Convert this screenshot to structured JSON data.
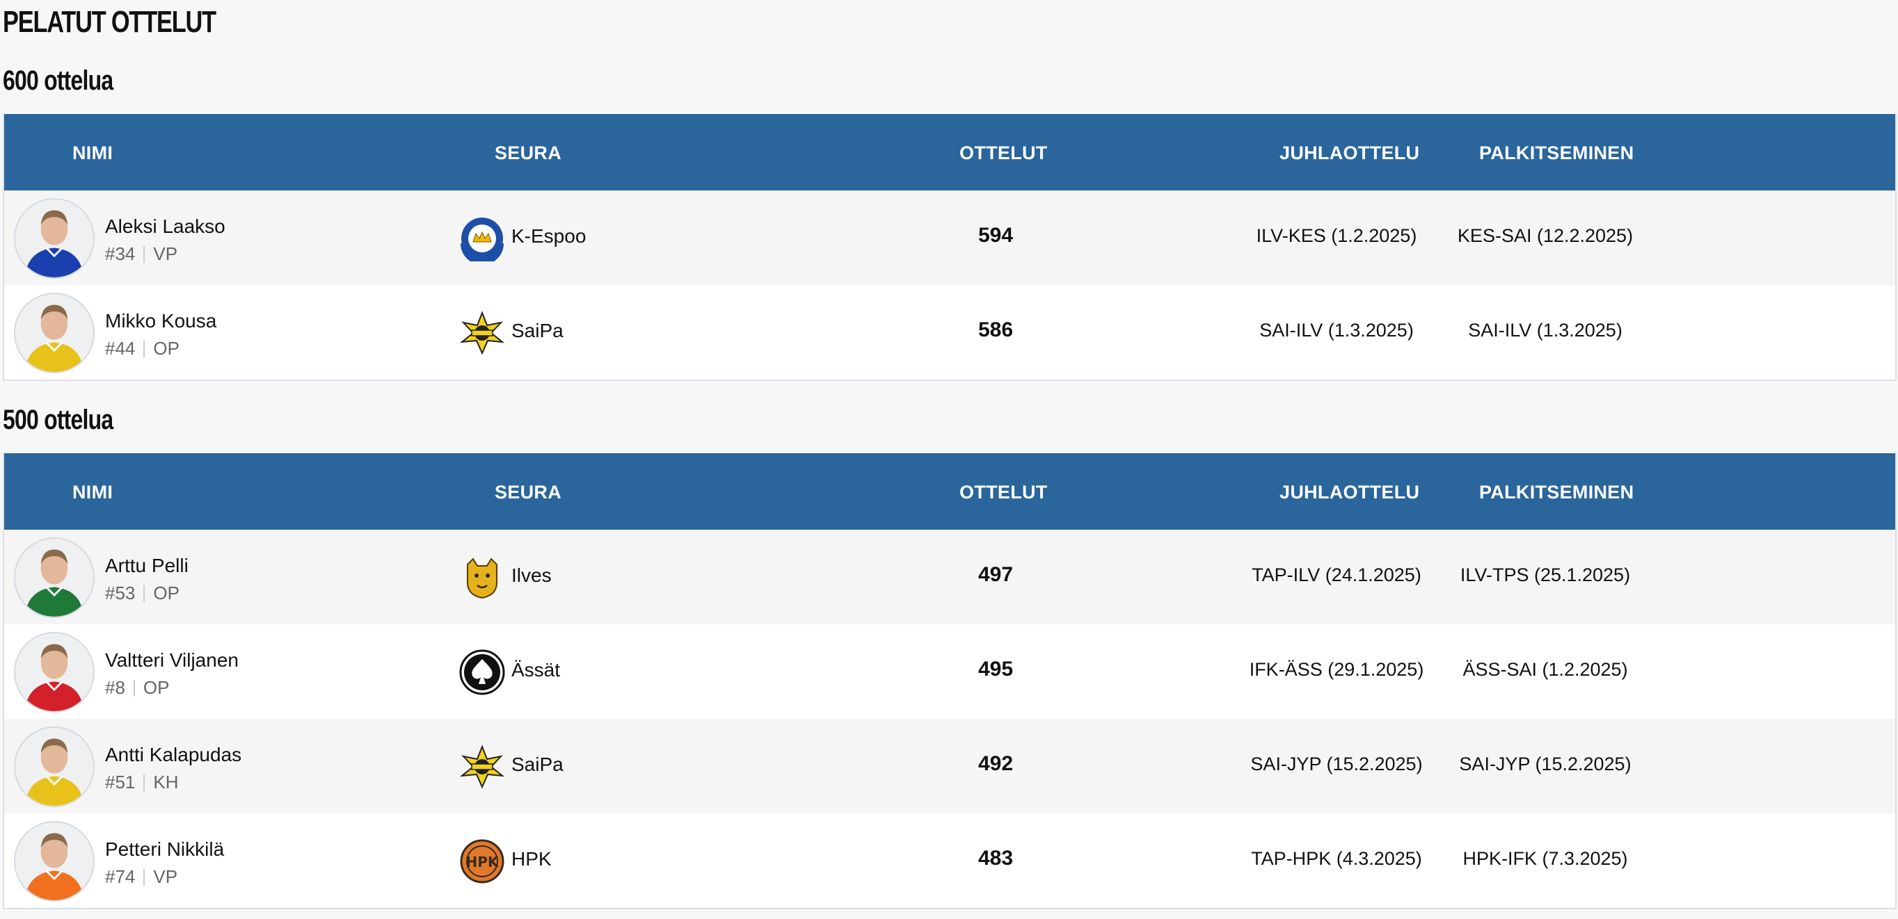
{
  "page_title": "PELATUT OTTELUT",
  "columns": {
    "name": "NIMI",
    "club": "SEURA",
    "games": "OTTELUT",
    "celebration": "JUHLAOTTELU",
    "award": "PALKITSEMINEN"
  },
  "sections": [
    {
      "title": "600 ottelua",
      "rows": [
        {
          "name": "Aleksi Laakso",
          "number": "#34",
          "position": "VP",
          "club": "K-Espoo",
          "club_logo": "k-espoo-logo",
          "games": "594",
          "celebration": "ILV-KES (1.2.2025)",
          "award": "KES-SAI (12.2.2025)",
          "jersey_color": "#1a3fae"
        },
        {
          "name": "Mikko Kousa",
          "number": "#44",
          "position": "OP",
          "club": "SaiPa",
          "club_logo": "saipa-logo",
          "games": "586",
          "celebration": "SAI-ILV (1.3.2025)",
          "award": "SAI-ILV (1.3.2025)",
          "jersey_color": "#e8c21a"
        }
      ]
    },
    {
      "title": "500 ottelua",
      "rows": [
        {
          "name": "Arttu Pelli",
          "number": "#53",
          "position": "OP",
          "club": "Ilves",
          "club_logo": "ilves-logo",
          "games": "497",
          "celebration": "TAP-ILV (24.1.2025)",
          "award": "ILV-TPS (25.1.2025)",
          "jersey_color": "#1f7a3a"
        },
        {
          "name": "Valtteri Viljanen",
          "number": "#8",
          "position": "OP",
          "club": "Ässät",
          "club_logo": "assat-logo",
          "games": "495",
          "celebration": "IFK-ÄSS (29.1.2025)",
          "award": "ÄSS-SAI (1.2.2025)",
          "jersey_color": "#d4202a"
        },
        {
          "name": "Antti Kalapudas",
          "number": "#51",
          "position": "KH",
          "club": "SaiPa",
          "club_logo": "saipa-logo",
          "games": "492",
          "celebration": "SAI-JYP (15.2.2025)",
          "award": "SAI-JYP (15.2.2025)",
          "jersey_color": "#e8c21a"
        },
        {
          "name": "Petteri Nikkilä",
          "number": "#74",
          "position": "VP",
          "club": "HPK",
          "club_logo": "hpk-logo",
          "games": "483",
          "celebration": "TAP-HPK (4.3.2025)",
          "award": "HPK-IFK (7.3.2025)",
          "jersey_color": "#f07020"
        }
      ]
    }
  ],
  "colors": {
    "header_bg": "#2a659c",
    "page_bg": "#f6f7f9"
  }
}
